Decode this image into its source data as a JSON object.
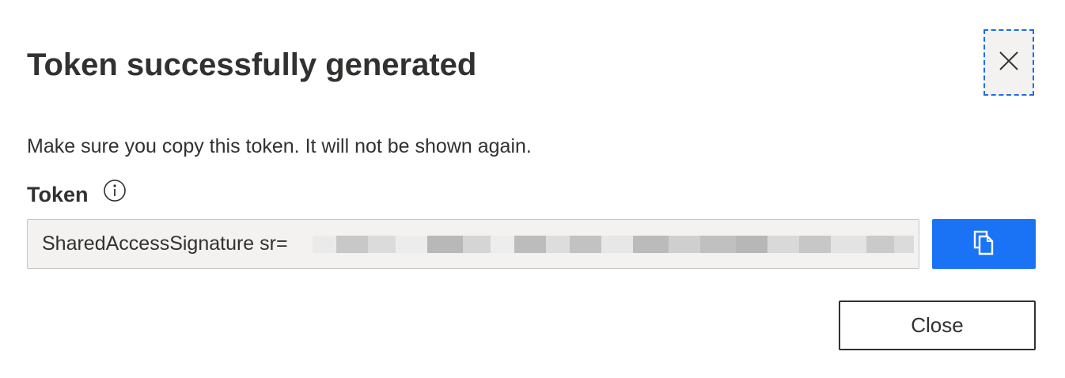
{
  "dialog": {
    "title": "Token successfully generated",
    "close_icon": "close-x-icon",
    "message": "Make sure you copy this token. It will not be shown again.",
    "token": {
      "label": "Token",
      "info_icon": "info-icon",
      "value": "SharedAccessSignature sr=",
      "copy_icon": "copy-icon"
    },
    "close_label": "Close"
  },
  "colors": {
    "accent": "#1a73f5",
    "focus_outline": "#1e6fe6",
    "text": "#323130",
    "field_bg": "#f3f2f1"
  }
}
